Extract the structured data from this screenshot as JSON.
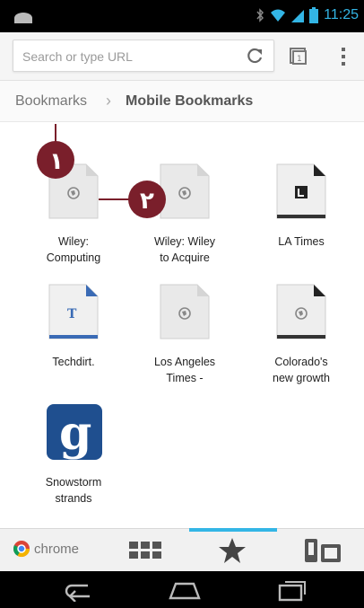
{
  "status_bar": {
    "time": "11:25"
  },
  "toolbar": {
    "url_placeholder": "Search or type URL"
  },
  "breadcrumb": {
    "root": "Bookmarks",
    "separator": "›",
    "current": "Mobile Bookmarks"
  },
  "bookmarks": [
    {
      "label": "Wiley:\nComputing",
      "icon": "globe-icon"
    },
    {
      "label": "Wiley: Wiley\nto Acquire",
      "icon": "globe-icon"
    },
    {
      "label": "LA Times",
      "icon": "la-times-favicon"
    },
    {
      "label": "Techdirt.",
      "icon": "techdirt-favicon"
    },
    {
      "label": "Los Angeles\nTimes -",
      "icon": "globe-icon"
    },
    {
      "label": "Colorado's\nnew growth",
      "icon": "globe-icon"
    },
    {
      "label": "Snowstorm\nstrands",
      "icon": "g-logo-icon"
    }
  ],
  "callouts": [
    {
      "number": "١"
    },
    {
      "number": "٢"
    }
  ],
  "bottom_bar": {
    "chrome_label": "chrome"
  },
  "colors": {
    "accent": "#33b5e5",
    "callout": "#7a1f2b"
  }
}
